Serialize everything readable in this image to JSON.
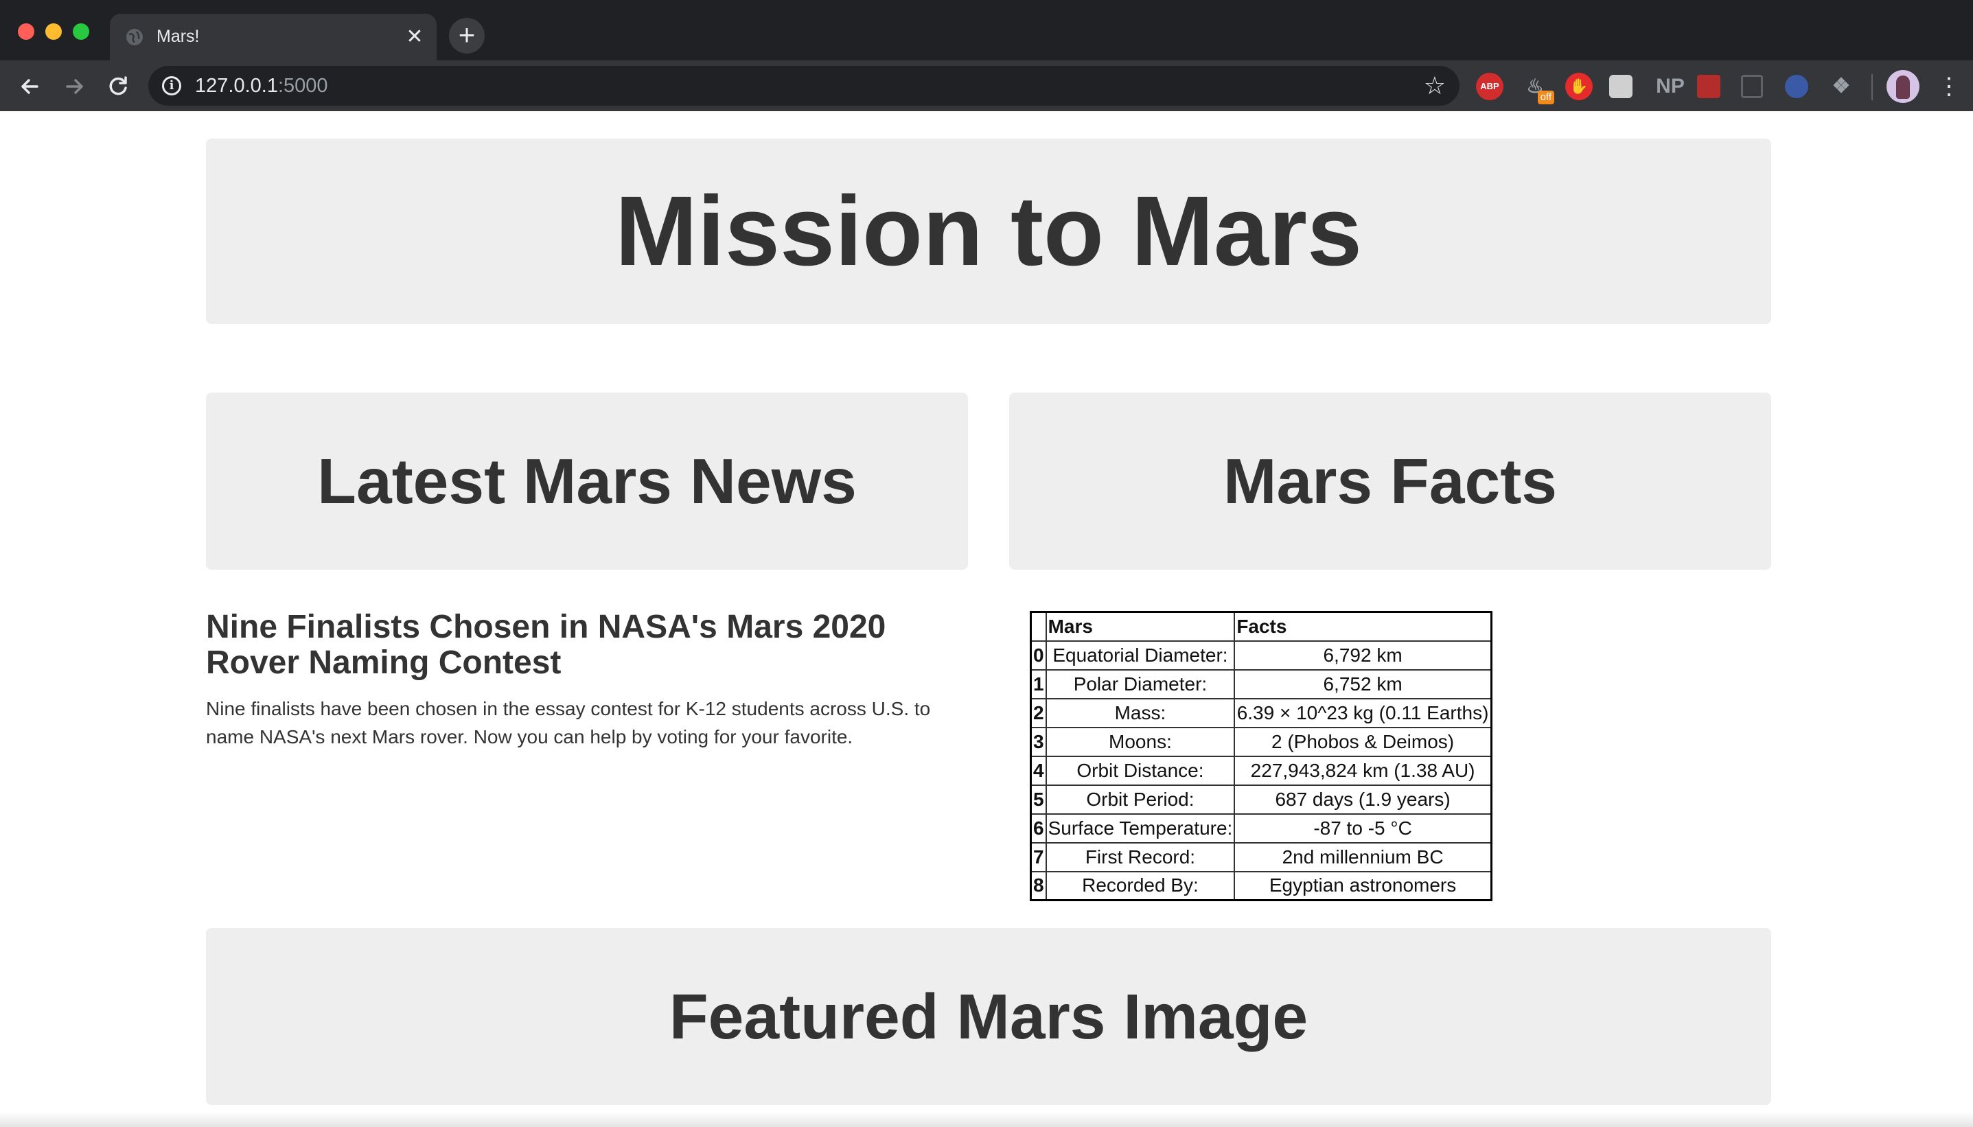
{
  "browser": {
    "tab_title": "Mars!",
    "tab_close_glyph": "✕",
    "new_tab_glyph": "+",
    "url_host": "127.0.0.1",
    "url_port": ":5000",
    "extensions": {
      "abp_label": "ABP",
      "fire_badge": "off",
      "np_label": "NP"
    },
    "icons": [
      "back-arrow-icon",
      "forward-arrow-icon",
      "reload-icon",
      "info-icon",
      "star-icon",
      "menu-icon"
    ],
    "colors": {
      "chrome_bg": "#35363a",
      "tabstrip_bg": "#202124",
      "text": "#e8eaed"
    }
  },
  "page": {
    "title": "Mission to Mars",
    "news_heading": "Latest Mars News",
    "facts_heading": "Mars Facts",
    "featured_heading": "Featured Mars Image",
    "news": {
      "title": "Nine Finalists Chosen in NASA's Mars 2020 Rover Naming Contest",
      "paragraph": "Nine finalists have been chosen in the essay contest for K-12 students across U.S. to name NASA's next Mars rover. Now you can help by voting for your favorite."
    },
    "facts_table": {
      "headers": [
        "",
        "Mars",
        "Facts"
      ],
      "rows": [
        [
          "0",
          "Equatorial Diameter:",
          "6,792 km"
        ],
        [
          "1",
          "Polar Diameter:",
          "6,752 km"
        ],
        [
          "2",
          "Mass:",
          "6.39 × 10^23 kg (0.11 Earths)"
        ],
        [
          "3",
          "Moons:",
          "2 (Phobos & Deimos)"
        ],
        [
          "4",
          "Orbit Distance:",
          "227,943,824 km (1.38 AU)"
        ],
        [
          "5",
          "Orbit Period:",
          "687 days (1.9 years)"
        ],
        [
          "6",
          "Surface Temperature:",
          "-87 to -5 °C"
        ],
        [
          "7",
          "First Record:",
          "2nd millennium BC"
        ],
        [
          "8",
          "Recorded By:",
          "Egyptian astronomers"
        ]
      ]
    },
    "colors": {
      "jumbotron_bg": "#eeeeee",
      "heading_text": "#333333"
    }
  }
}
